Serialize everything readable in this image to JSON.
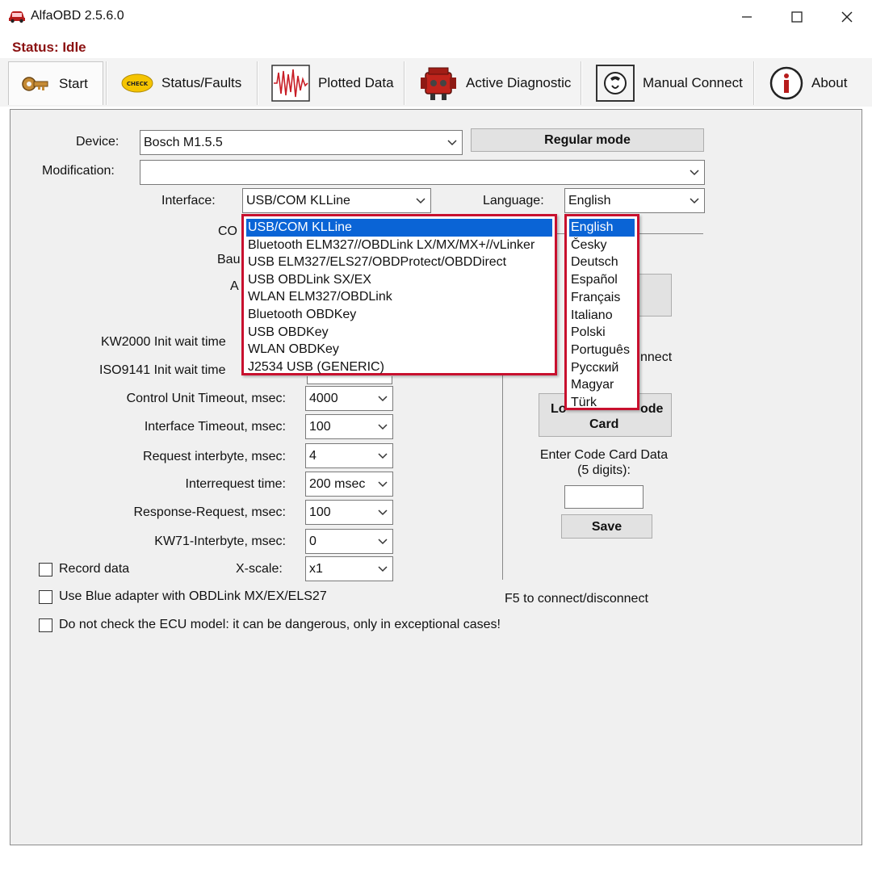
{
  "window": {
    "title": "AlfaOBD 2.5.6.0",
    "minimize": "–",
    "maximize": "☐",
    "close": "✕"
  },
  "status": "Status: Idle",
  "toolbar": {
    "start": "Start",
    "status_faults": "Status/Faults",
    "plotted_data": "Plotted Data",
    "active_diagnostic": "Active Diagnostic",
    "manual_connect": "Manual Connect",
    "about": "About",
    "check_badge": "CHECK"
  },
  "form": {
    "device_label": "Device:",
    "device_value": "Bosch M1.5.5",
    "regular_mode": "Regular mode",
    "modification_label": "Modification:",
    "modification_value": "",
    "interface_label": "Interface:",
    "interface_value": "USB/COM KLLine",
    "language_label": "Language:",
    "language_value": "English",
    "com_label_partial": "CO",
    "baud_label_partial": "Bau",
    "a_label_partial": "A",
    "kw2000_label": "KW2000 Init wait time",
    "iso9141_label": "ISO9141 Init wait time",
    "cu_timeout_label": "Control Unit Timeout, msec:",
    "cu_timeout_value": "4000",
    "if_timeout_label": "Interface Timeout, msec:",
    "if_timeout_value": "100",
    "req_interbyte_label": "Request interbyte, msec:",
    "req_interbyte_value": "4",
    "interrequest_label": "Interrequest time:",
    "interrequest_value": "200 msec",
    "resp_req_label": "Response-Request, msec:",
    "resp_req_value": "100",
    "kw71_label": "KW71-Interbyte, msec:",
    "kw71_value": "0",
    "record_data_label": "Record data",
    "xscale_label": "X-scale:",
    "xscale_value": "x1",
    "blue_adapter_label": "Use Blue adapter with OBDLink MX/EX/ELS27",
    "no_check_ecu_label": "Do not check the ECU model: it can be dangerous, only in exceptional cases!"
  },
  "right_panel": {
    "connect_partial": "nnect",
    "login_code_card": "Login with Code Card",
    "login_visible_top": "Lo",
    "login_visible_right": "ode",
    "login_visible_bottom": "Card",
    "enter_code_label": "Enter Code Card Data (5 digits):",
    "enter_code_line1": "Enter Code Card Data",
    "enter_code_line2": "(5 digits):",
    "save_button": "Save",
    "f5_hint": "F5 to connect/disconnect"
  },
  "interface_dropdown": {
    "selected_index": 0,
    "options": [
      "USB/COM KLLine",
      "Bluetooth ELM327//OBDLink LX/MX/MX+//vLinker",
      "USB ELM327/ELS27/OBDProtect/OBDDirect",
      "USB OBDLink SX/EX",
      "WLAN ELM327/OBDLink",
      "Bluetooth OBDKey",
      "USB OBDKey",
      "WLAN OBDKey",
      "J2534 USB (GENERIC)"
    ]
  },
  "language_dropdown": {
    "selected_index": 0,
    "options": [
      "English",
      "Česky",
      "Deutsch",
      "Español",
      "Français",
      "Italiano",
      "Polski",
      "Português",
      "Русский",
      "Magyar",
      "Türk"
    ]
  },
  "colors": {
    "status_text": "#8b1111",
    "dropdown_border": "#c8102e",
    "selection": "#0a64d6"
  }
}
